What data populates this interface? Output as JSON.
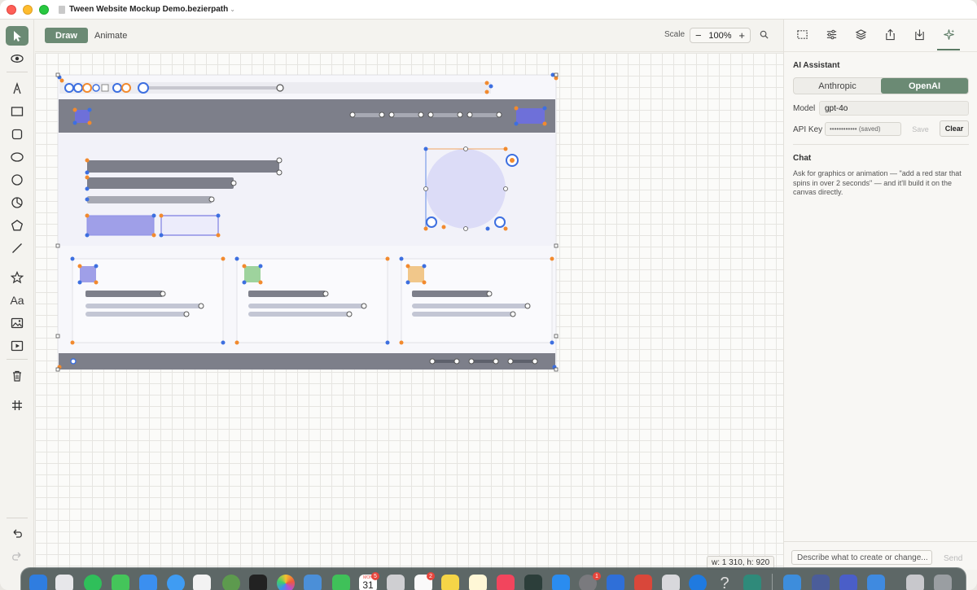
{
  "window": {
    "title": "Tween Website Mockup Demo.bezierpath"
  },
  "modes": {
    "draw": "Draw",
    "animate": "Animate"
  },
  "scale": {
    "label": "Scale",
    "minus": "−",
    "value": "100%",
    "plus": "+"
  },
  "tools": [
    "select",
    "eye",
    "pen",
    "rectangle",
    "rounded-rectangle",
    "ellipse",
    "circle",
    "pie",
    "polygon",
    "line",
    "star",
    "text",
    "image",
    "video",
    "trash",
    "grid",
    "undo",
    "redo"
  ],
  "canvas": {
    "dimensions": "w: 1 310, h: 920"
  },
  "panel": {
    "ai_title": "AI Assistant",
    "providers": [
      "Anthropic",
      "OpenAI"
    ],
    "selected_provider": "OpenAI",
    "model_label": "Model",
    "model_value": "gpt-4o",
    "api_key_label": "API Key",
    "api_key_value": "•••••••••••• (saved)",
    "save_label": "Save",
    "clear_label": "Clear",
    "chat_title": "Chat",
    "chat_description": "Ask for graphics or animation — \"add a red star that spins in over 2 seconds\" — and it'll build it on the canvas directly.",
    "chat_placeholder": "Describe what to create or change...",
    "send_label": "Send"
  },
  "dock": {
    "calendar_month": "MON",
    "calendar_day": "31",
    "badges": [
      "5",
      "2",
      "1"
    ]
  },
  "colors": {
    "accent": "#6b8a74",
    "header_bar": "#7d7f8a",
    "purple": "#8f90e6",
    "circle_fill": "#dcdcf7"
  }
}
